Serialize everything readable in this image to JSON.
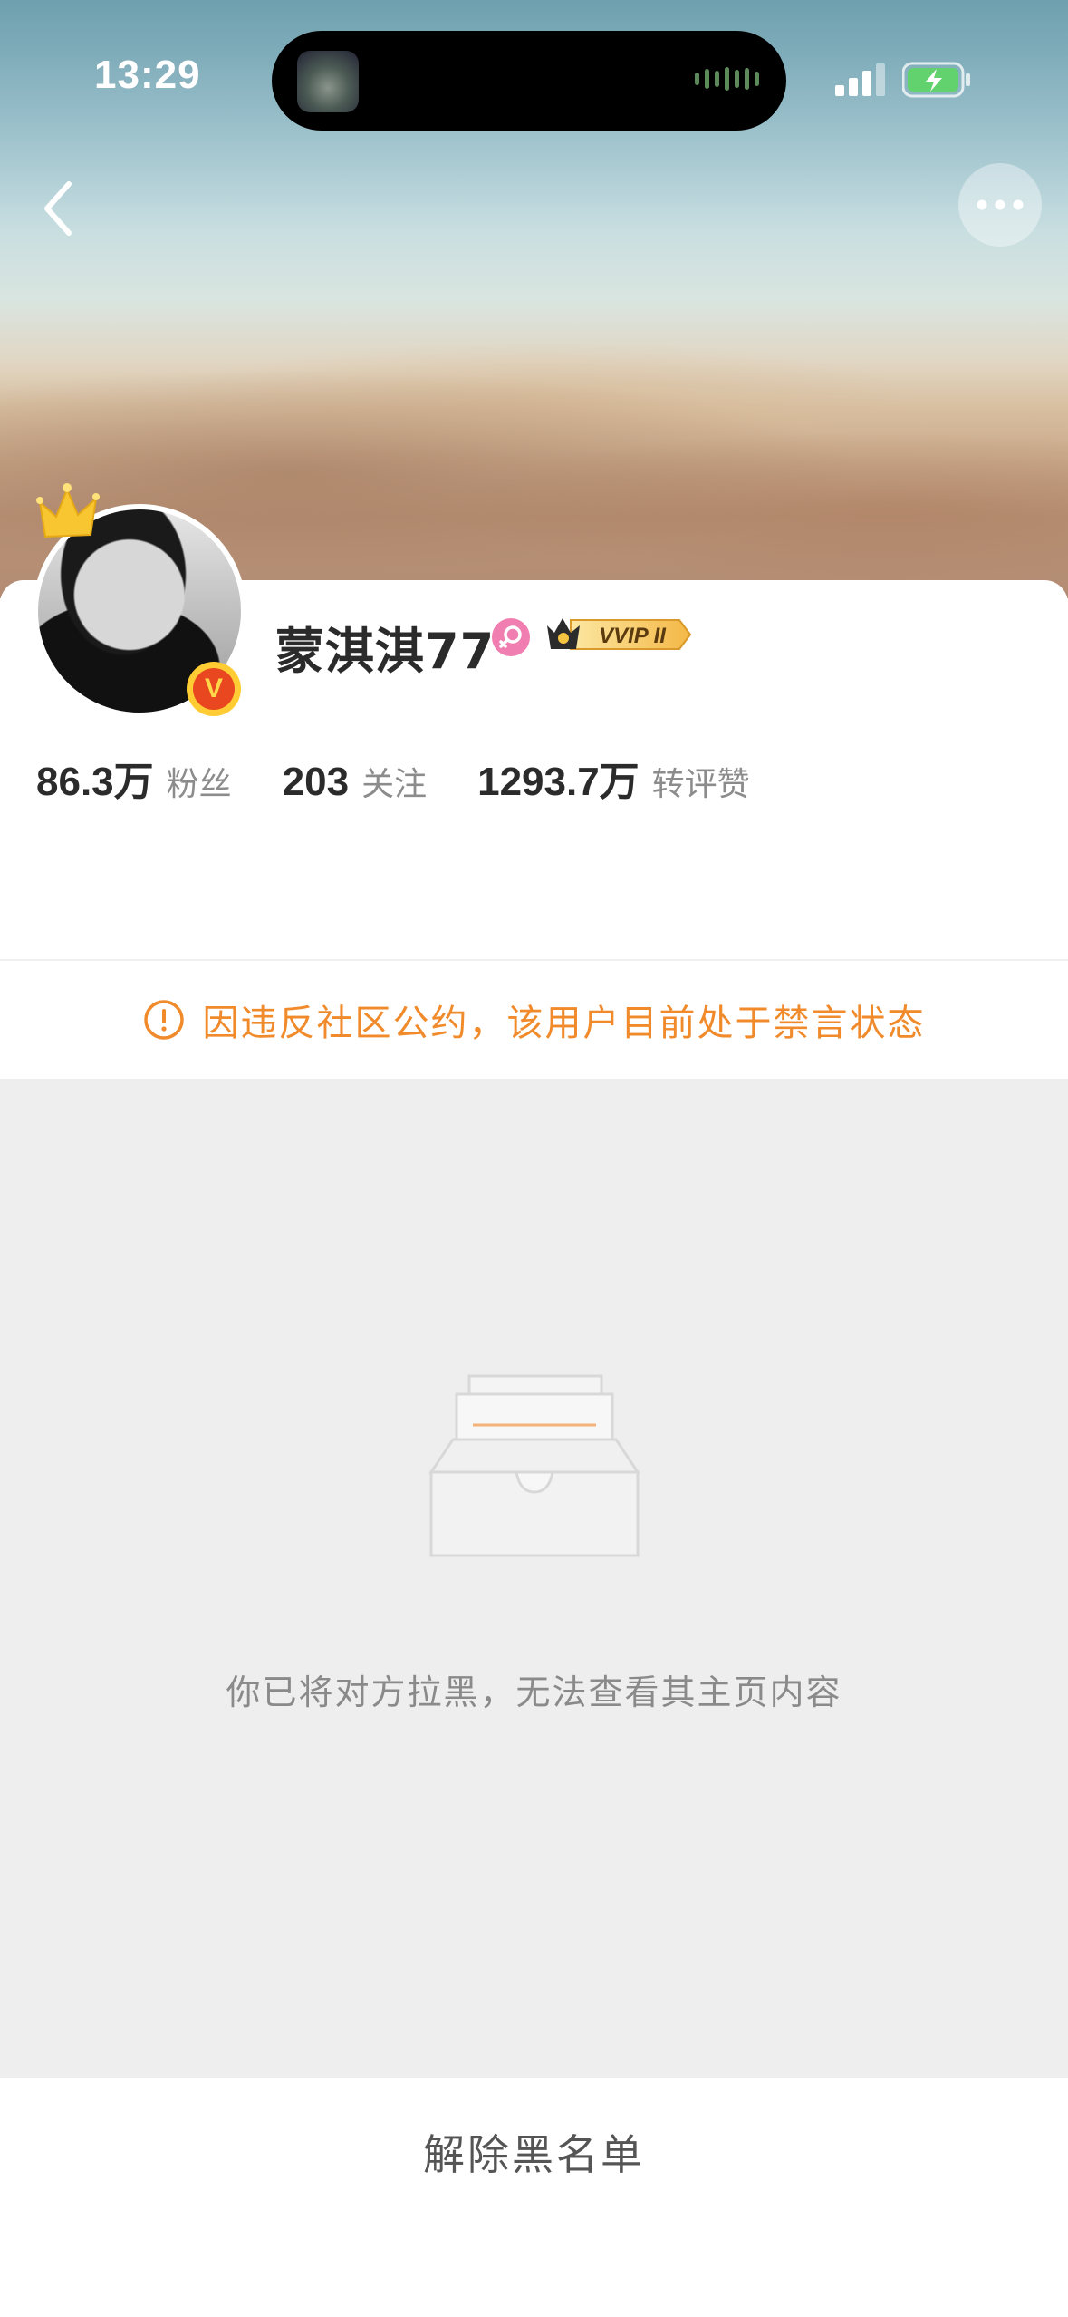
{
  "status_bar": {
    "time": "13:29",
    "icons": [
      "now-playing-artwork",
      "audio-waveform-icon",
      "cellular-signal-icon",
      "battery-charging-icon"
    ]
  },
  "nav": {
    "back_icon": "chevron-left-icon",
    "more_icon": "ellipsis-icon"
  },
  "profile": {
    "name": "蒙淇淇77",
    "gender_icon": "female-icon",
    "vip_badge_text": "VVIP II",
    "verified_badge_text": "V",
    "stats": [
      {
        "value": "86.3万",
        "label": "粉丝"
      },
      {
        "value": "203",
        "label": "关注"
      },
      {
        "value": "1293.7万",
        "label": "转评赞"
      }
    ]
  },
  "notice": {
    "icon": "exclamation-circle-icon",
    "text": "因违反社区公约，该用户目前处于禁言状态",
    "color": "#f08a2b"
  },
  "blocked": {
    "illustration": "empty-tray-icon",
    "message": "你已将对方拉黑，无法查看其主页内容"
  },
  "actions": {
    "unblock_label": "解除黑名单"
  }
}
